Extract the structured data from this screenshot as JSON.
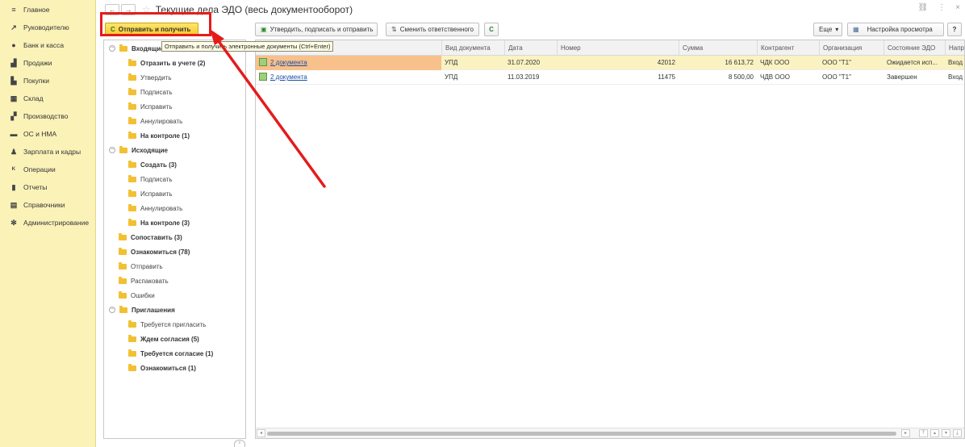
{
  "nav": {
    "items": [
      {
        "label": "Главное",
        "icon": "menu-icon",
        "glyph": "≡"
      },
      {
        "label": "Руководителю",
        "icon": "trend-icon",
        "glyph": "↗"
      },
      {
        "label": "Банк и касса",
        "icon": "coin-icon",
        "glyph": "●"
      },
      {
        "label": "Продажи",
        "icon": "bag-icon",
        "glyph": "▟"
      },
      {
        "label": "Покупки",
        "icon": "cart-icon",
        "glyph": "▙"
      },
      {
        "label": "Склад",
        "icon": "warehouse-icon",
        "glyph": "▦"
      },
      {
        "label": "Производство",
        "icon": "factory-icon",
        "glyph": "▞"
      },
      {
        "label": "ОС и НМА",
        "icon": "truck-icon",
        "glyph": "▬"
      },
      {
        "label": "Зарплата и кадры",
        "icon": "person-icon",
        "glyph": "♟"
      },
      {
        "label": "Операции",
        "icon": "operations-icon",
        "glyph": "ᴷ"
      },
      {
        "label": "Отчеты",
        "icon": "report-icon",
        "glyph": "▮"
      },
      {
        "label": "Справочники",
        "icon": "book-icon",
        "glyph": "▤"
      },
      {
        "label": "Администрирование",
        "icon": "gear-icon",
        "glyph": "✻"
      }
    ]
  },
  "window": {
    "title": "Текущие дела ЭДО (весь документооборот)",
    "back": "←",
    "forward": "→",
    "star": "☆",
    "link_icon": "🔗",
    "more_icon": "⋮",
    "close_icon": "×"
  },
  "toolbar": {
    "send_receive": "Отправить и получить",
    "approve_sign_send": "Утвердить, подписать и отправить",
    "change_responsible": "Сменить ответственного",
    "refresh_icon": "C",
    "more": "Еще",
    "view_settings": "Настройка просмотра",
    "help": "?",
    "tooltip": "Отправить и получить электронные документы (Ctrl+Enter)"
  },
  "tree": [
    {
      "label": "Входящие",
      "level": 0,
      "bold": true,
      "collapse": true
    },
    {
      "label": "Отразить в учете (2)",
      "level": 1,
      "bold": true
    },
    {
      "label": "Утвердить",
      "level": 1,
      "bold": false
    },
    {
      "label": "Подписать",
      "level": 1,
      "bold": false
    },
    {
      "label": "Исправить",
      "level": 1,
      "bold": false
    },
    {
      "label": "Аннулировать",
      "level": 1,
      "bold": false
    },
    {
      "label": "На контроле (1)",
      "level": 1,
      "bold": true
    },
    {
      "label": "Исходящие",
      "level": 0,
      "bold": true,
      "collapse": true
    },
    {
      "label": "Создать (3)",
      "level": 1,
      "bold": true
    },
    {
      "label": "Подписать",
      "level": 1,
      "bold": false
    },
    {
      "label": "Исправить",
      "level": 1,
      "bold": false
    },
    {
      "label": "Аннулировать",
      "level": 1,
      "bold": false
    },
    {
      "label": "На контроле (3)",
      "level": 1,
      "bold": true
    },
    {
      "label": "Сопоставить (3)",
      "level": 0,
      "bold": true
    },
    {
      "label": "Ознакомиться (78)",
      "level": 0,
      "bold": true
    },
    {
      "label": "Отправить",
      "level": 0,
      "bold": false
    },
    {
      "label": "Распаковать",
      "level": 0,
      "bold": false
    },
    {
      "label": "Ошибки",
      "level": 0,
      "bold": false
    },
    {
      "label": "Приглашения",
      "level": 0,
      "bold": true,
      "collapse": true
    },
    {
      "label": "Требуется пригласить",
      "level": 1,
      "bold": false
    },
    {
      "label": "Ждем согласия (5)",
      "level": 1,
      "bold": true
    },
    {
      "label": "Требуется согласие (1)",
      "level": 1,
      "bold": true
    },
    {
      "label": "Ознакомиться (1)",
      "level": 1,
      "bold": true
    }
  ],
  "table": {
    "columns": [
      "Вид документа",
      "Дата",
      "Номер",
      "Сумма",
      "Контрагент",
      "Организация",
      "Состояние ЭДО",
      "Напр"
    ],
    "rows": [
      {
        "doc": "2 документа",
        "type": "УПД",
        "date": "31.07.2020",
        "number": "42012",
        "sum": "16 613,72",
        "counterparty": "ЧДК ООО",
        "org": "ООО \"Т1\"",
        "state": "Ожидается исп...",
        "dir": "Вход",
        "selected": true
      },
      {
        "doc": "2 документа",
        "type": "УПД",
        "date": "11.03.2019",
        "number": "11475",
        "sum": "8 500,00",
        "counterparty": "ЧДВ ООО",
        "org": "ООО \"Т1\"",
        "state": "Завершен",
        "dir": "Вход",
        "selected": false
      }
    ]
  },
  "colors": {
    "nav_bg": "#fbf2b8",
    "primary_button": "#f5c82d",
    "callout_red": "#e51b1b",
    "selected_row": "#fbf2c2",
    "link": "#1a4fa8"
  }
}
